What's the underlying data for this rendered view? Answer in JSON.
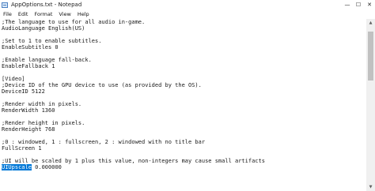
{
  "window": {
    "title": "AppOptions.txt - Notepad",
    "controls": {
      "minimize": "—",
      "maximize": "☐",
      "close": "✕"
    }
  },
  "menu": [
    "File",
    "Edit",
    "Format",
    "View",
    "Help"
  ],
  "editor": {
    "lines": [
      ";The language to use for all audio in-game.",
      "AudioLanguage English(US)",
      "",
      ";Set to 1 to enable subtitles.",
      "EnableSubtitles 0",
      "",
      ";Enable language fall-back.",
      "EnableFallback 1",
      "",
      "[Video]",
      ";Device ID of the GPU device to use (as provided by the OS).",
      "DeviceID 5122",
      "",
      ";Render width in pixels.",
      "RenderWidth 1360",
      "",
      ";Render height in pixels.",
      "RenderHeight 768",
      "",
      ";0 : windowed, 1 : fullscreen, 2 : windowed with no title bar",
      "FullScreen 1",
      "",
      ";UI will be scaled by 1 plus this value, non-integers may cause small artifacts"
    ],
    "last_line": {
      "selected": "UIUpscale",
      "rest": " 0.000000"
    },
    "selection_color": "#0078d7"
  },
  "scrollbar": {
    "up": "▲",
    "down": "▼"
  }
}
